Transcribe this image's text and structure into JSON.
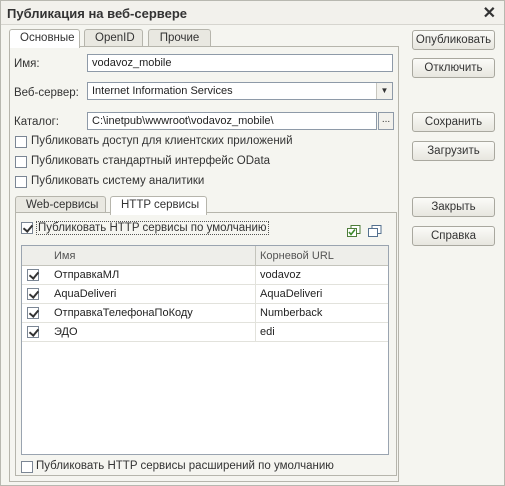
{
  "window": {
    "title": "Публикация на веб-сервере"
  },
  "tabs": [
    {
      "label": "Основные",
      "active": true
    },
    {
      "label": "OpenID",
      "active": false
    },
    {
      "label": "Прочие",
      "active": false
    }
  ],
  "form": {
    "name_label": "Имя:",
    "name_value": "vodavoz_mobile",
    "server_label": "Веб-сервер:",
    "server_value": "Internet Information Services",
    "catalog_label": "Каталог:",
    "catalog_value": "C:\\inetpub\\wwwroot\\vodavoz_mobile\\",
    "dots_label": "...",
    "checks": [
      {
        "label": "Публиковать доступ для клиентских приложений",
        "checked": false
      },
      {
        "label": "Публиковать стандартный интерфейс OData",
        "checked": false
      },
      {
        "label": "Публиковать систему аналитики",
        "checked": false
      }
    ]
  },
  "inner_tabs": [
    {
      "label": "Web-сервисы",
      "active": false
    },
    {
      "label": "HTTP сервисы",
      "active": true
    }
  ],
  "http": {
    "publish_default_label": "Публиковать HTTP сервисы по умолчанию",
    "publish_default_checked": true,
    "columns": [
      "Имя",
      "Корневой URL"
    ],
    "rows": [
      {
        "checked": true,
        "name": "ОтправкаМЛ",
        "url": "vodavoz"
      },
      {
        "checked": true,
        "name": "AquaDeliveri",
        "url": "AquaDeliveri"
      },
      {
        "checked": true,
        "name": "ОтправкаТелефонаПоКоду",
        "url": "Numberback"
      },
      {
        "checked": true,
        "name": "ЭДО",
        "url": "edi"
      }
    ],
    "publish_ext_label": "Публиковать HTTP сервисы расширений по умолчанию",
    "publish_ext_checked": false
  },
  "buttons": {
    "publish": "Опубликовать",
    "disable": "Отключить",
    "save": "Сохранить",
    "load": "Загрузить",
    "close": "Закрыть",
    "help": "Справка"
  },
  "icons": {
    "close": "close-icon",
    "check_all": "check-all-icon",
    "uncheck_all": "uncheck-all-icon"
  }
}
